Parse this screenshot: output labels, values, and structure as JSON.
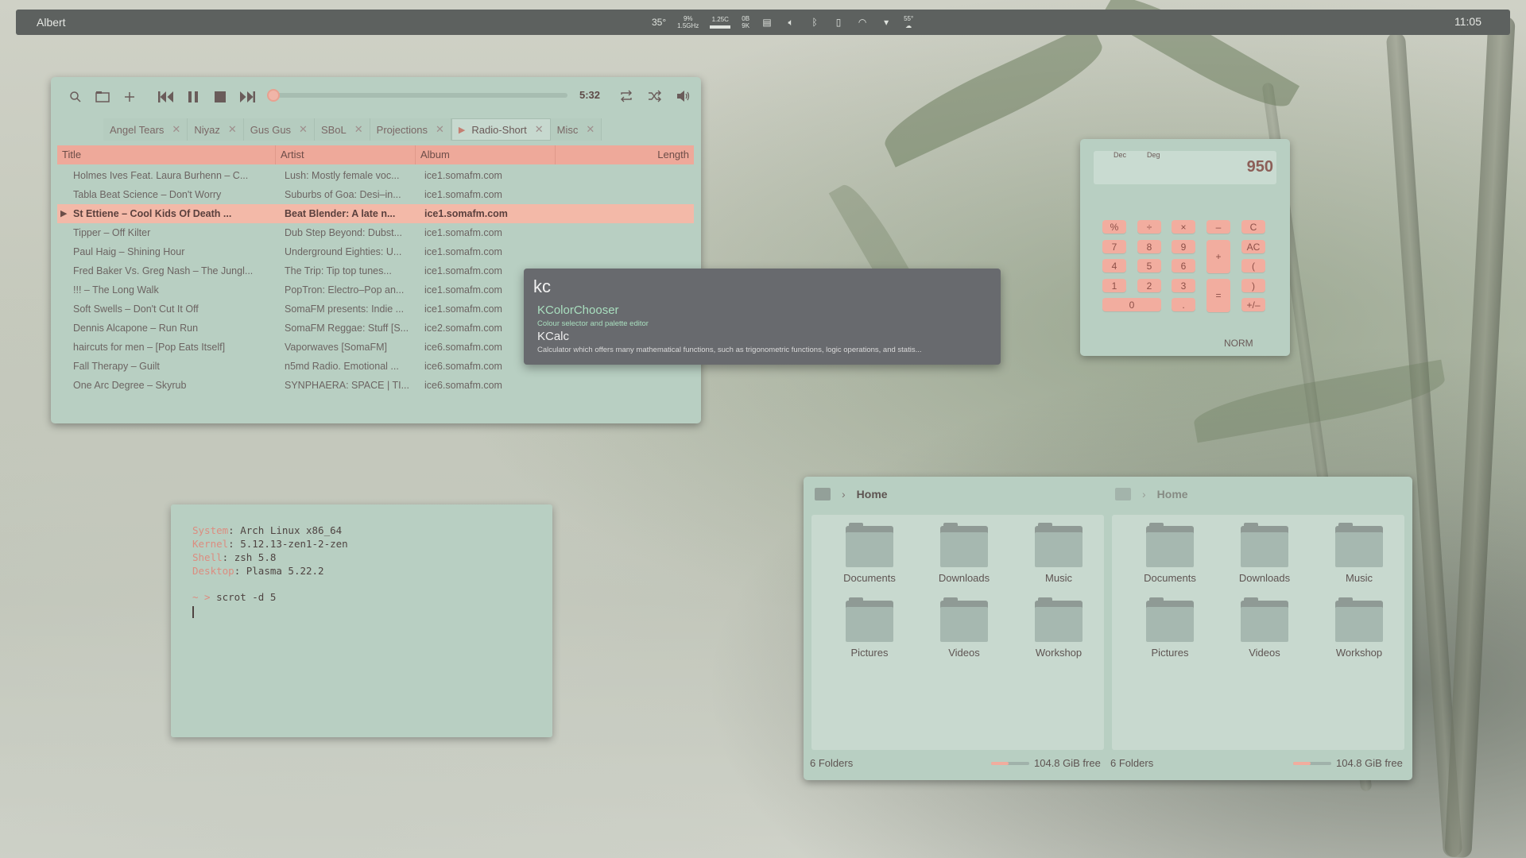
{
  "panel": {
    "launcher": "Albert",
    "cpu_temp": "35°",
    "cpu_freq_top": "9%",
    "cpu_freq": "1.5GHz",
    "gpu": "1.25C",
    "net_up": "0B",
    "net_down": "9K",
    "weather": "55°",
    "clock": "11:05"
  },
  "player": {
    "time": "5:32",
    "progress": 0.0,
    "tabs": [
      {
        "label": "Angel Tears"
      },
      {
        "label": "Niyaz"
      },
      {
        "label": "Gus Gus"
      },
      {
        "label": "SBoL"
      },
      {
        "label": "Projections"
      },
      {
        "label": "Radio-Short"
      },
      {
        "label": "Misc"
      }
    ],
    "columns": {
      "title": "Title",
      "artist": "Artist",
      "album": "Album",
      "length": "Length"
    },
    "rows": [
      {
        "title": "Holmes Ives Feat. Laura Burhenn – C...",
        "artist": "Lush: Mostly female voc...",
        "album": "ice1.somafm.com"
      },
      {
        "title": "Tabla Beat Science – Don't Worry",
        "artist": "Suburbs of Goa: Desi–in...",
        "album": "ice1.somafm.com"
      },
      {
        "title": "St Ettiene – Cool Kids Of Death ...",
        "artist": "Beat Blender: A late n...",
        "album": "ice1.somafm.com"
      },
      {
        "title": "Tipper – Off Kilter",
        "artist": "Dub Step Beyond: Dubst...",
        "album": "ice1.somafm.com"
      },
      {
        "title": "Paul Haig – Shining Hour",
        "artist": "Underground Eighties: U...",
        "album": "ice1.somafm.com"
      },
      {
        "title": "Fred Baker Vs. Greg Nash – The Jungl...",
        "artist": "The Trip:  Tip top tunes...",
        "album": "ice1.somafm.com"
      },
      {
        "title": "!!! – The Long Walk",
        "artist": "PopTron: Electro–Pop an...",
        "album": "ice1.somafm.com"
      },
      {
        "title": "Soft Swells – Don't Cut It Off",
        "artist": "SomaFM presents: Indie ...",
        "album": "ice1.somafm.com"
      },
      {
        "title": "Dennis Alcapone – Run Run",
        "artist": "SomaFM Reggae: Stuff [S...",
        "album": "ice2.somafm.com"
      },
      {
        "title": "haircuts for men – [Pop Eats Itself]",
        "artist": "Vaporwaves [SomaFM]",
        "album": "ice6.somafm.com"
      },
      {
        "title": "Fall Therapy – Guilt",
        "artist": "n5md Radio. Emotional ...",
        "album": "ice6.somafm.com"
      },
      {
        "title": "One Arc Degree – Skyrub",
        "artist": "SYNPHAERA: SPACE | TI...",
        "album": "ice6.somafm.com"
      }
    ]
  },
  "albert": {
    "query": "kc",
    "results": [
      {
        "name": "KColorChooser",
        "desc": "Colour selector and palette editor"
      },
      {
        "name": "KCalc",
        "desc": "Calculator which offers many mathematical functions, such as trigonometric functions, logic operations, and statis..."
      }
    ]
  },
  "calc": {
    "mode_base": "Dec",
    "mode_angle": "Deg",
    "value": "950",
    "status": "NORM",
    "keys": [
      "%",
      "÷",
      "×",
      "–",
      "C",
      "7",
      "8",
      "9",
      "+",
      "AC",
      "4",
      "5",
      "6",
      "(",
      "1",
      "2",
      "3",
      "=",
      ")",
      "0",
      ".",
      "+/–"
    ]
  },
  "terminal": {
    "lines": [
      {
        "key": "System",
        "value": "Arch Linux x86_64"
      },
      {
        "key": "Kernel",
        "value": "5.12.13-zen1-2-zen"
      },
      {
        "key": "Shell",
        "value": "zsh 5.8"
      },
      {
        "key": "Desktop",
        "value": "Plasma 5.22.2"
      }
    ],
    "prompt": "~ > ",
    "command": "scrot -d 5"
  },
  "filemanager": {
    "panes": [
      {
        "breadcrumb": "Home",
        "folders": [
          "Documents",
          "Downloads",
          "Music",
          "Pictures",
          "Videos",
          "Workshop"
        ],
        "status": "6 Folders",
        "free": "104.8 GiB free"
      },
      {
        "breadcrumb": "Home",
        "folders": [
          "Documents",
          "Downloads",
          "Music",
          "Pictures",
          "Videos",
          "Workshop"
        ],
        "status": "6 Folders",
        "free": "104.8 GiB free"
      }
    ],
    "disk_used_fraction": 0.45
  },
  "colors": {
    "accent": "#f2ad9f",
    "window": "#b8cfc2",
    "panel": "#5d615f"
  }
}
